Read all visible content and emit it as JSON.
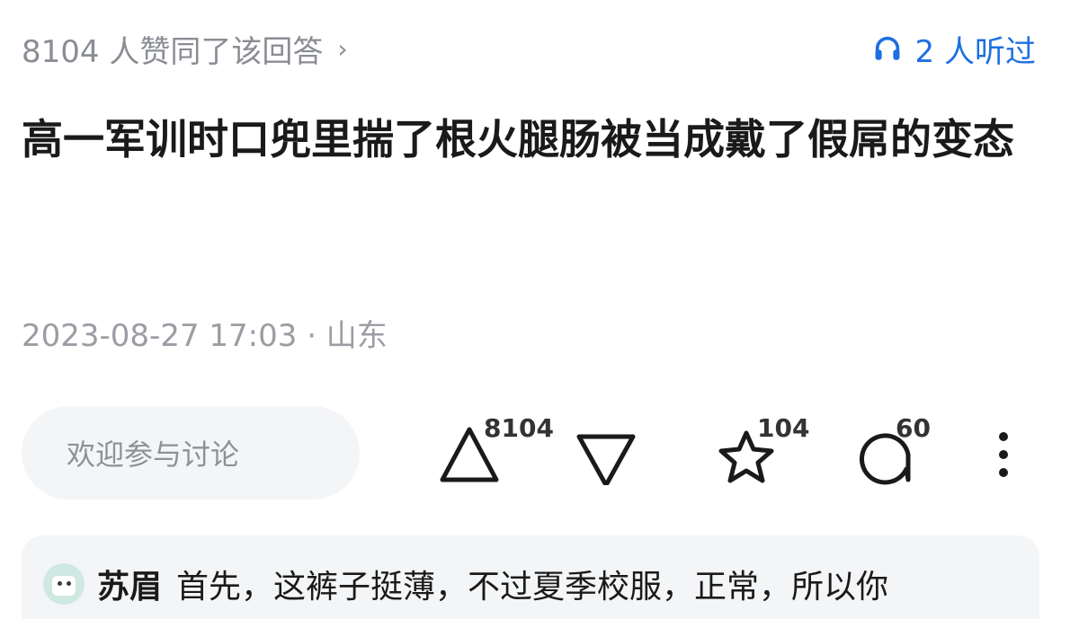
{
  "header": {
    "likes_text": "8104 人赞同了该回答",
    "likes_chevron": "›",
    "listened_text": "2 人听过"
  },
  "question": {
    "title": "高一军训时口兜里揣了根火腿肠被当成戴了假屌的变态",
    "meta": "2023-08-27 17:03 · 山东"
  },
  "actions": {
    "comment_placeholder": "欢迎参与讨论",
    "upvote_count": "8104",
    "favorite_count": "104",
    "comment_count": "60"
  },
  "colors": {
    "accent": "#1e6fe0",
    "muted": "#8a8d93",
    "surface": "#f4f5f7"
  },
  "comment_preview": {
    "author": "苏眉",
    "text": "首先，这裤子挺薄，不过夏季校服，正常，所以你"
  }
}
